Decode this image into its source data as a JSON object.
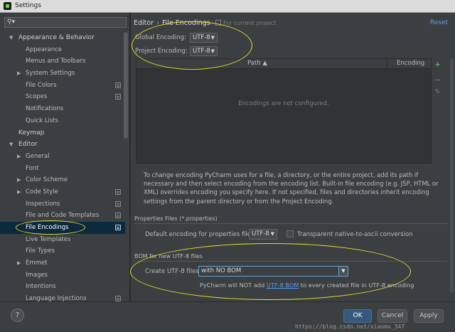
{
  "window": {
    "title": "Settings",
    "icon": "pycharm-app-icon"
  },
  "search": {
    "placeholder": ""
  },
  "sidebar": {
    "items": [
      {
        "label": "Appearance & Behavior",
        "arrow": "▼"
      },
      {
        "label": "Appearance"
      },
      {
        "label": "Menus and Toolbars"
      },
      {
        "label": "System Settings",
        "arrow": "▶"
      },
      {
        "label": "File Colors"
      },
      {
        "label": "Scopes"
      },
      {
        "label": "Notifications"
      },
      {
        "label": "Quick Lists"
      },
      {
        "label": "Keymap"
      },
      {
        "label": "Editor",
        "arrow": "▼"
      },
      {
        "label": "General",
        "arrow": "▶"
      },
      {
        "label": "Font"
      },
      {
        "label": "Color Scheme",
        "arrow": "▶"
      },
      {
        "label": "Code Style",
        "arrow": "▶"
      },
      {
        "label": "Inspections"
      },
      {
        "label": "File and Code Templates"
      },
      {
        "label": "File Encodings"
      },
      {
        "label": "Live Templates"
      },
      {
        "label": "File Types"
      },
      {
        "label": "Emmet",
        "arrow": "▶"
      },
      {
        "label": "Images"
      },
      {
        "label": "Intentions"
      },
      {
        "label": "Language Injections"
      }
    ],
    "selected": "File Encodings"
  },
  "breadcrumb": {
    "parent": "Editor",
    "separator": "›",
    "current": "File Encodings",
    "note": "For current project"
  },
  "reset_label": "Reset",
  "global_encoding": {
    "label": "Global Encoding:",
    "value": "UTF-8"
  },
  "project_encoding": {
    "label": "Project Encoding:",
    "value": "UTF-8"
  },
  "table": {
    "columns": [
      "Path ▲",
      "Encoding"
    ],
    "empty_message": "Encodings are not configured."
  },
  "table_buttons": {
    "add": "+",
    "remove": "−",
    "edit": "✎"
  },
  "help_text": "To change encoding PyCharm uses for a file, a directory, or the entire project, add its path if necessary and then select encoding from the encoding list. Built-in file encoding (e.g. JSP, HTML or XML) overrides encoding you specify here. If not specified, files and directories inherit encoding settings from the parent directory or from the Project Encoding.",
  "properties": {
    "group_title": "Properties Files (*.properties)",
    "default_label": "Default encoding for properties files:",
    "default_value": "UTF-8",
    "transparent_label": "Transparent native-to-ascii conversion",
    "transparent_checked": false
  },
  "bom": {
    "group_title": "BOM for new UTF-8 files",
    "create_label": "Create UTF-8 files:",
    "create_value": "with NO BOM",
    "note_prefix": "PyCharm will NOT add",
    "note_link": "UTF-8 BOM",
    "note_suffix": "to every created file in UTF-8 encoding"
  },
  "footer": {
    "help": "?",
    "ok": "OK",
    "cancel": "Cancel",
    "apply": "Apply",
    "watermark": "https://blog.csdn.net/xiaomu_347"
  },
  "colors": {
    "background": "#3c3f41",
    "selection": "#0d293e",
    "link": "#589df6",
    "annotation": "#e3e02a",
    "ok_button": "#365880"
  }
}
